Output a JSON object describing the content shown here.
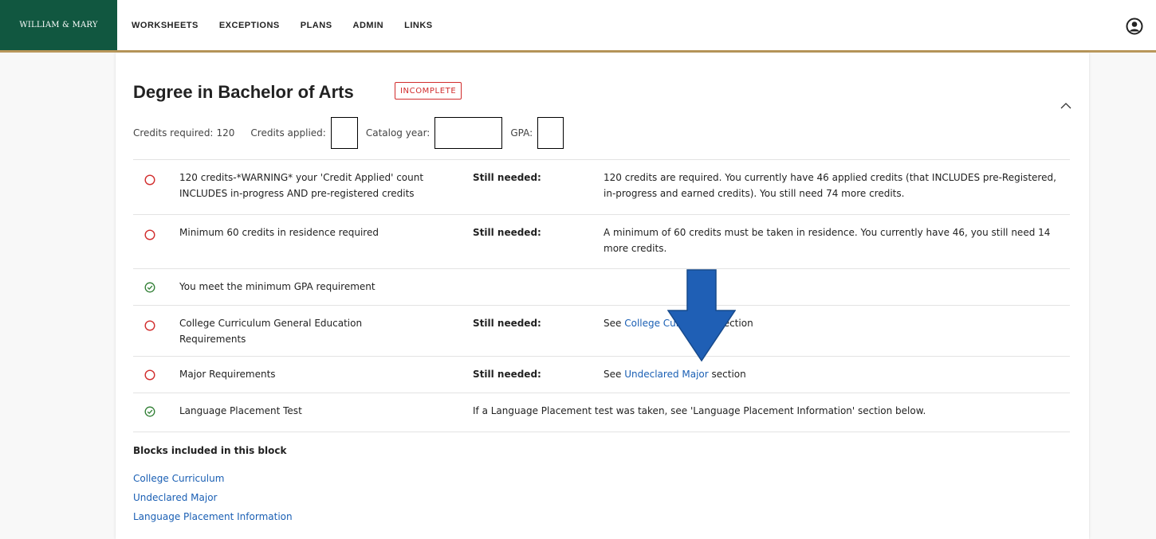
{
  "brand": "WILLIAM & MARY",
  "nav": [
    "WORKSHEETS",
    "EXCEPTIONS",
    "PLANS",
    "ADMIN",
    "LINKS"
  ],
  "degree": {
    "title": "Degree in Bachelor of Arts",
    "status": "INCOMPLETE",
    "credits_required_label": "Credits required:",
    "credits_required_value": "120",
    "credits_applied_label": "Credits applied:",
    "catalog_year_label": "Catalog year:",
    "gpa_label": "GPA:"
  },
  "requirements": [
    {
      "status": "incomplete",
      "name": "120 credits-*WARNING* your 'Credit Applied' count INCLUDES in-progress AND pre-registered credits",
      "needed": "Still needed:",
      "description": "120 credits are required. You currently have 46 applied credits (that INCLUDES pre-Registered, in-progress and earned credits). You still need 74 more credits."
    },
    {
      "status": "incomplete",
      "name": "Minimum 60 credits in residence required",
      "needed": "Still needed:",
      "description": "A minimum of 60 credits must be taken in residence. You currently have 46, you still need 14 more credits."
    },
    {
      "status": "complete",
      "name": "You meet the minimum GPA requirement"
    },
    {
      "status": "incomplete",
      "name": "College Curriculum General Education Requirements",
      "needed": "Still needed:",
      "desc_prefix": "See",
      "desc_link": "College Curriculum",
      "desc_suffix": "section"
    },
    {
      "status": "incomplete",
      "name": "Major Requirements",
      "needed": "Still needed:",
      "desc_prefix": "See",
      "desc_link": "Undeclared Major",
      "desc_suffix": "section"
    },
    {
      "status": "complete",
      "name": "Language Placement Test",
      "description": "If a Language Placement test was taken, see 'Language Placement Information' section below."
    }
  ],
  "blocks": {
    "heading": "Blocks included in this block",
    "links": [
      "College Curriculum",
      "Undeclared Major",
      "Language Placement Information"
    ]
  },
  "colors": {
    "brand_green": "#115740",
    "gold_rule": "#b9975b",
    "incomplete_red": "#d12c2c",
    "complete_green": "#2e7d32",
    "link_blue": "#1a5fb4",
    "annotation_arrow": "#1f5fb5"
  }
}
